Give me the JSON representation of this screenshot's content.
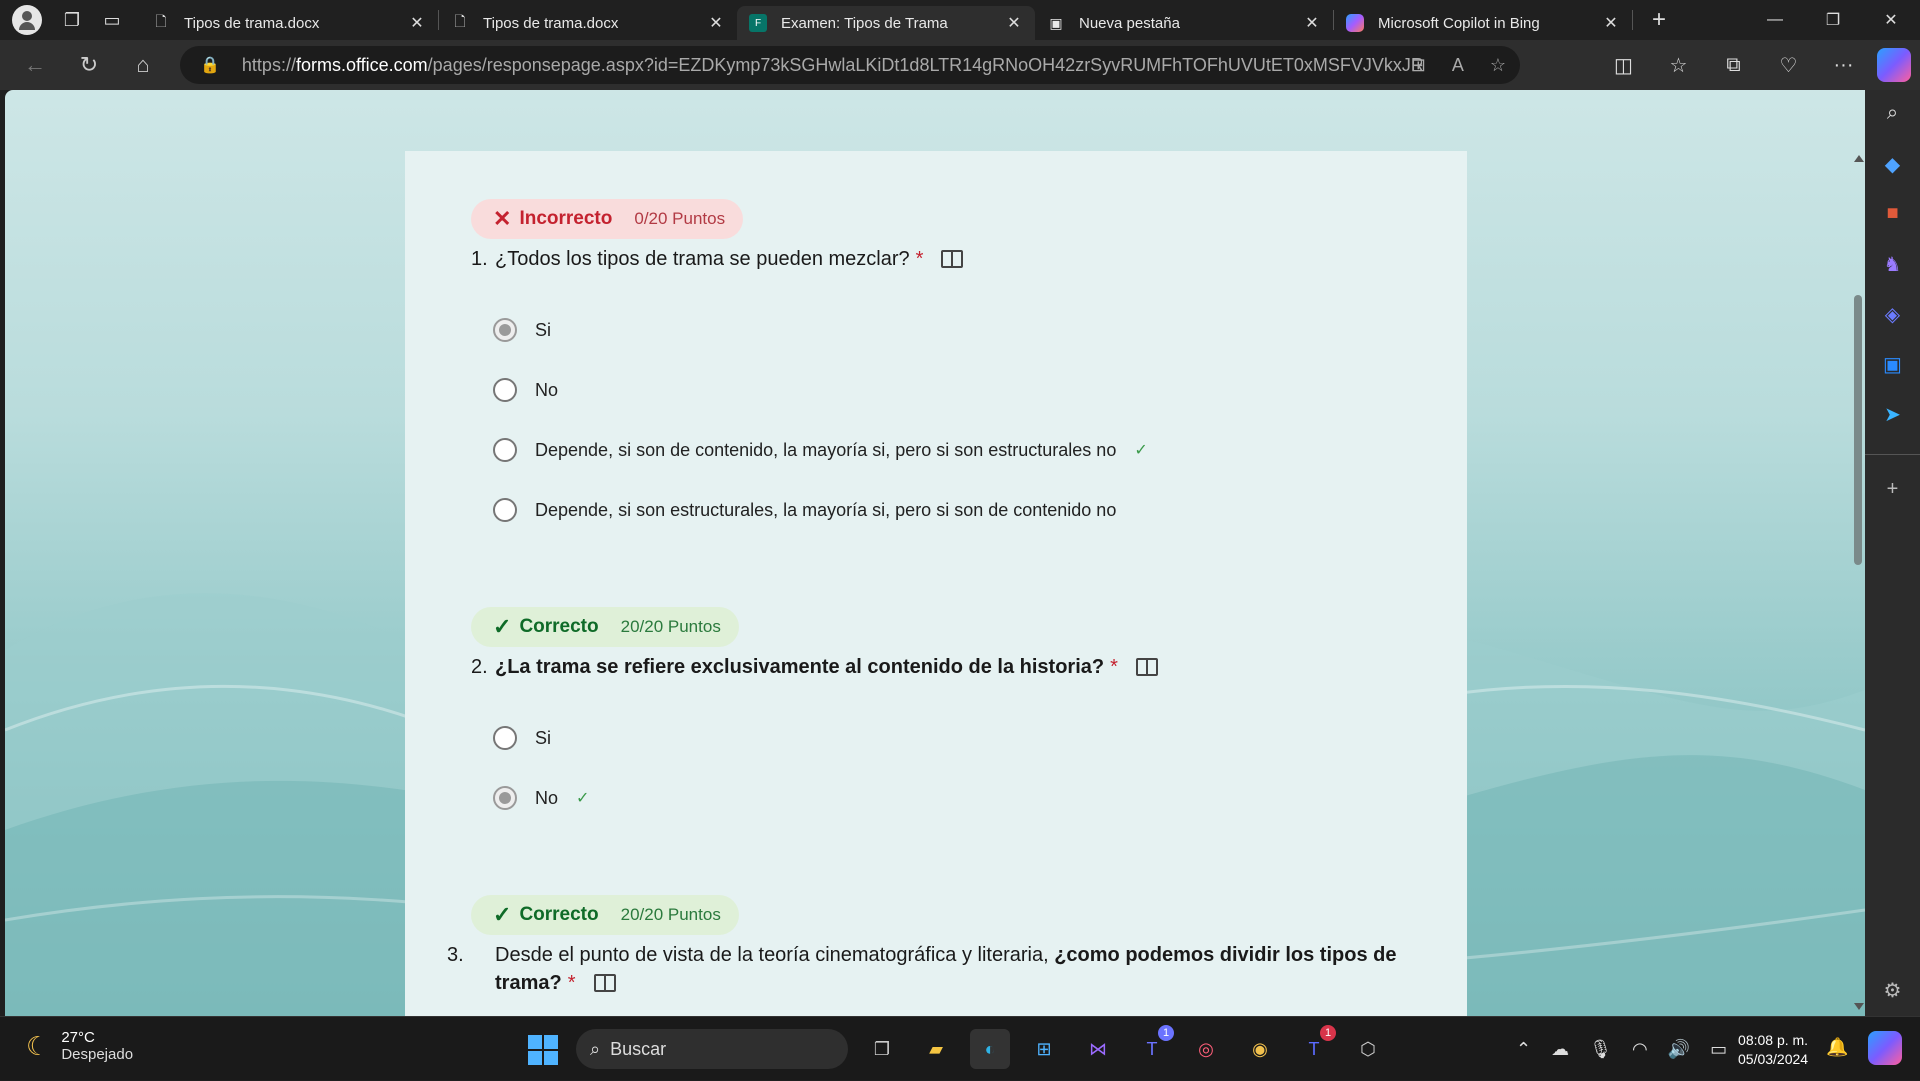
{
  "tabs": [
    {
      "title": "Tipos de trama.docx",
      "icon": "document-icon",
      "active": false
    },
    {
      "title": "Tipos de trama.docx",
      "icon": "document-icon",
      "active": false
    },
    {
      "title": "Examen: Tipos de Trama",
      "icon": "forms-icon",
      "active": true
    },
    {
      "title": "Nueva pestaña",
      "icon": "newtab-icon",
      "active": false
    },
    {
      "title": "Microsoft Copilot in Bing",
      "icon": "copilot-icon",
      "active": false
    }
  ],
  "address": {
    "prefix": "https://",
    "domain": "forms.office.com",
    "path": "/pages/responsepage.aspx?id=EZDKymp73kSGHwlaLKiDt1d8LTR14gRNoOH42zrSyvRUMFhTOFhUVUtET0xMSFVJVkxJRkpGOEQx..."
  },
  "quiz": {
    "q1": {
      "status": "Incorrecto",
      "points": "0/20 Puntos",
      "number": "1.",
      "text": "¿Todos los tipos de trama se pueden mezclar?",
      "required": "*",
      "options": [
        {
          "label": "Si",
          "selected": true,
          "correct": false
        },
        {
          "label": "No",
          "selected": false,
          "correct": false
        },
        {
          "label": "Depende, si son de contenido, la mayoría si, pero si son estructurales no",
          "selected": false,
          "correct": true
        },
        {
          "label": "Depende, si son estructurales, la mayoría si, pero si son de contenido no",
          "selected": false,
          "correct": false
        }
      ]
    },
    "q2": {
      "status": "Correcto",
      "points": "20/20 Puntos",
      "number": "2.",
      "text": "¿La trama se refiere exclusivamente al contenido de la historia?",
      "required": "*",
      "options": [
        {
          "label": "Si",
          "selected": false,
          "correct": false
        },
        {
          "label": "No",
          "selected": true,
          "correct": true
        }
      ]
    },
    "q3": {
      "status": "Correcto",
      "points": "20/20 Puntos",
      "number": "3.",
      "text_plain": "Desde el punto de vista de la teoría cinematográfica y literaria, ",
      "text_bold": "¿como podemos dividir los tipos de trama?",
      "required": "*"
    }
  },
  "taskbar": {
    "temperature": "27°C",
    "weather": "Despejado",
    "search_placeholder": "Buscar",
    "time": "08:08 p. m.",
    "date": "05/03/2024",
    "teams_badge": "1",
    "teams_new_badge": "1"
  },
  "colors": {
    "incorrect": "#c4222f",
    "correct": "#0f6b28",
    "accent": "#4fb3ff"
  }
}
